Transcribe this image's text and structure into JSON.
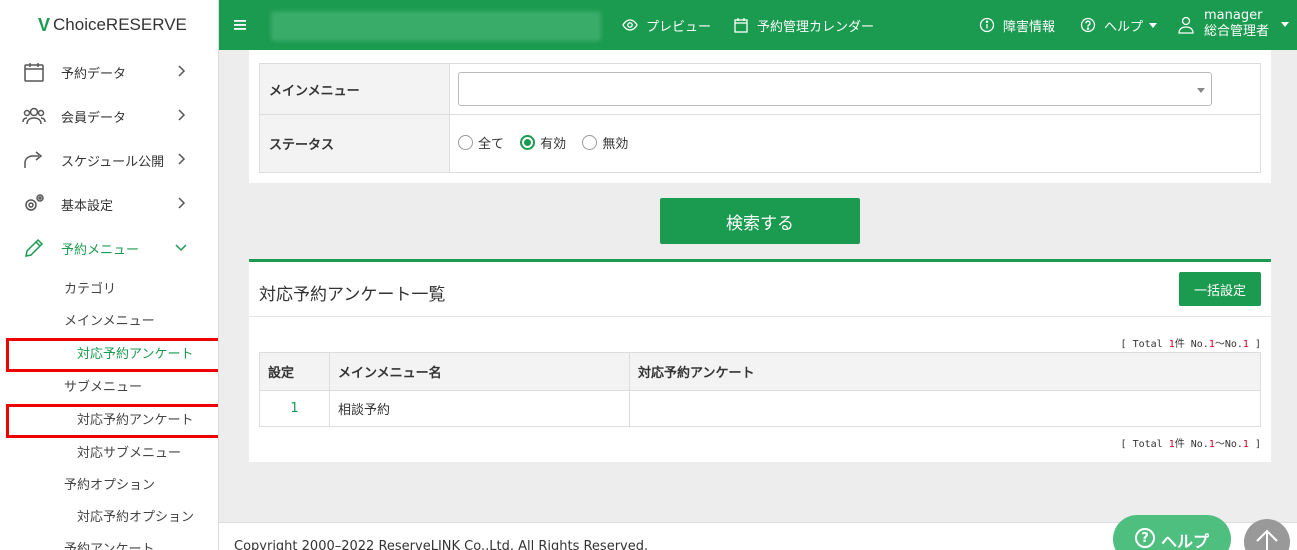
{
  "logo": {
    "mark": "V",
    "text": "ChoiceRESERVE"
  },
  "sidebar": {
    "items": [
      {
        "label": "予約データ",
        "icon": "calendar-icon"
      },
      {
        "label": "会員データ",
        "icon": "users-icon"
      },
      {
        "label": "スケジュール公開",
        "icon": "share-icon"
      },
      {
        "label": "基本設定",
        "icon": "gear-icon"
      },
      {
        "label": "予約メニュー",
        "icon": "pencil-icon"
      }
    ],
    "sub_items": [
      "カテゴリ",
      "メインメニュー",
      "対応予約アンケート",
      "サブメニュー",
      "対応予約アンケート",
      "対応サブメニュー",
      "予約オプション",
      "対応予約オプション",
      "予約アンケート"
    ]
  },
  "topbar": {
    "preview": "プレビュー",
    "calendar": "予約管理カレンダー",
    "incident": "障害情報",
    "help": "ヘルプ",
    "user_name": "manager",
    "user_role": "総合管理者"
  },
  "filter": {
    "main_menu_label": "メインメニュー",
    "main_menu_value": "",
    "status_label": "ステータス",
    "status_options": [
      "全て",
      "有効",
      "無効"
    ],
    "status_selected": "有効"
  },
  "search_button": "検索する",
  "list": {
    "title": "対応予約アンケート一覧",
    "bulk_button": "一括設定",
    "total_prefix": "[ Total ",
    "total_count": "1",
    "total_mid": "件 No.",
    "total_from": "1",
    "total_sep": "〜No.",
    "total_to": "1",
    "total_suffix": " ]",
    "columns": [
      "設定",
      "メインメニュー名",
      "対応予約アンケート"
    ],
    "rows": [
      {
        "setting": "1",
        "main_menu": "相談予約",
        "survey": ""
      }
    ]
  },
  "footer": "Copyright 2000–2022 ReserveLINK Co.,Ltd. All Rights Reserved.",
  "help_fab": "ヘルプ",
  "colors": {
    "brand": "#1a9b4f",
    "highlight": "#e00000"
  }
}
